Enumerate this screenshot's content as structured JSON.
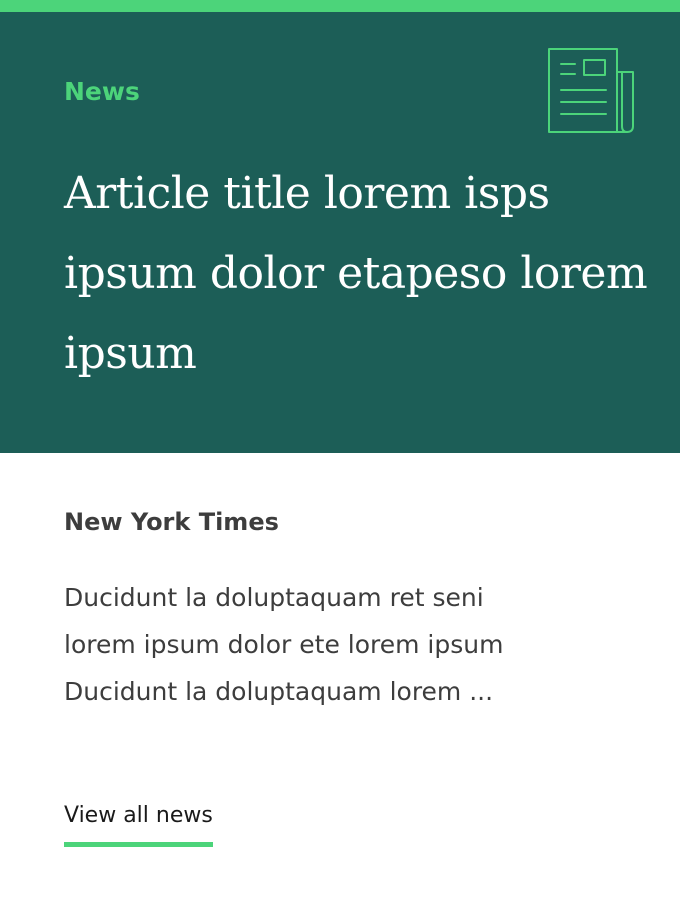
{
  "card": {
    "category": "News",
    "icon": "newspaper-icon",
    "title": "Article title lorem isps ipsum dolor etapeso lorem ipsum",
    "source": "New York Times",
    "excerpt": "Ducidunt la doluptaquam ret seni\nlorem ipsum dolor ete lorem ipsum\nDucidunt la doluptaquam lorem  ...",
    "link_label": "View all news"
  },
  "colors": {
    "accent": "#4cd47a",
    "hero_background": "#1c5e57",
    "text_dark": "#3d3d3d",
    "background": "#ffffff"
  }
}
